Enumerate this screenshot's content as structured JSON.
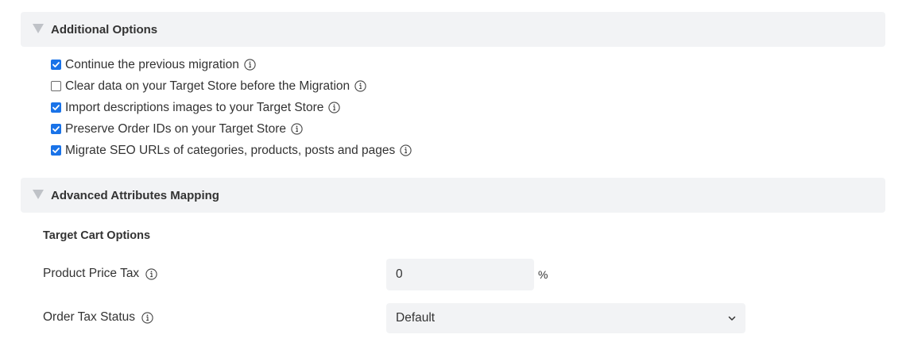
{
  "additional_options": {
    "title": "Additional Options",
    "items": [
      {
        "label": "Continue the previous migration",
        "checked": true
      },
      {
        "label": "Clear data on your Target Store before the Migration",
        "checked": false
      },
      {
        "label": "Import descriptions images to your Target Store",
        "checked": true
      },
      {
        "label": "Preserve Order IDs on your Target Store",
        "checked": true
      },
      {
        "label": "Migrate SEO URLs of categories, products, posts and pages",
        "checked": true
      }
    ]
  },
  "advanced_mapping": {
    "title": "Advanced Attributes Mapping",
    "subtitle": "Target Cart Options",
    "product_price_tax": {
      "label": "Product Price Tax",
      "value": "0",
      "unit": "%"
    },
    "order_tax_status": {
      "label": "Order Tax Status",
      "selected": "Default"
    }
  },
  "colors": {
    "checkbox_accent": "#1a73e8",
    "header_bg": "#f2f3f5",
    "text": "#333333"
  }
}
